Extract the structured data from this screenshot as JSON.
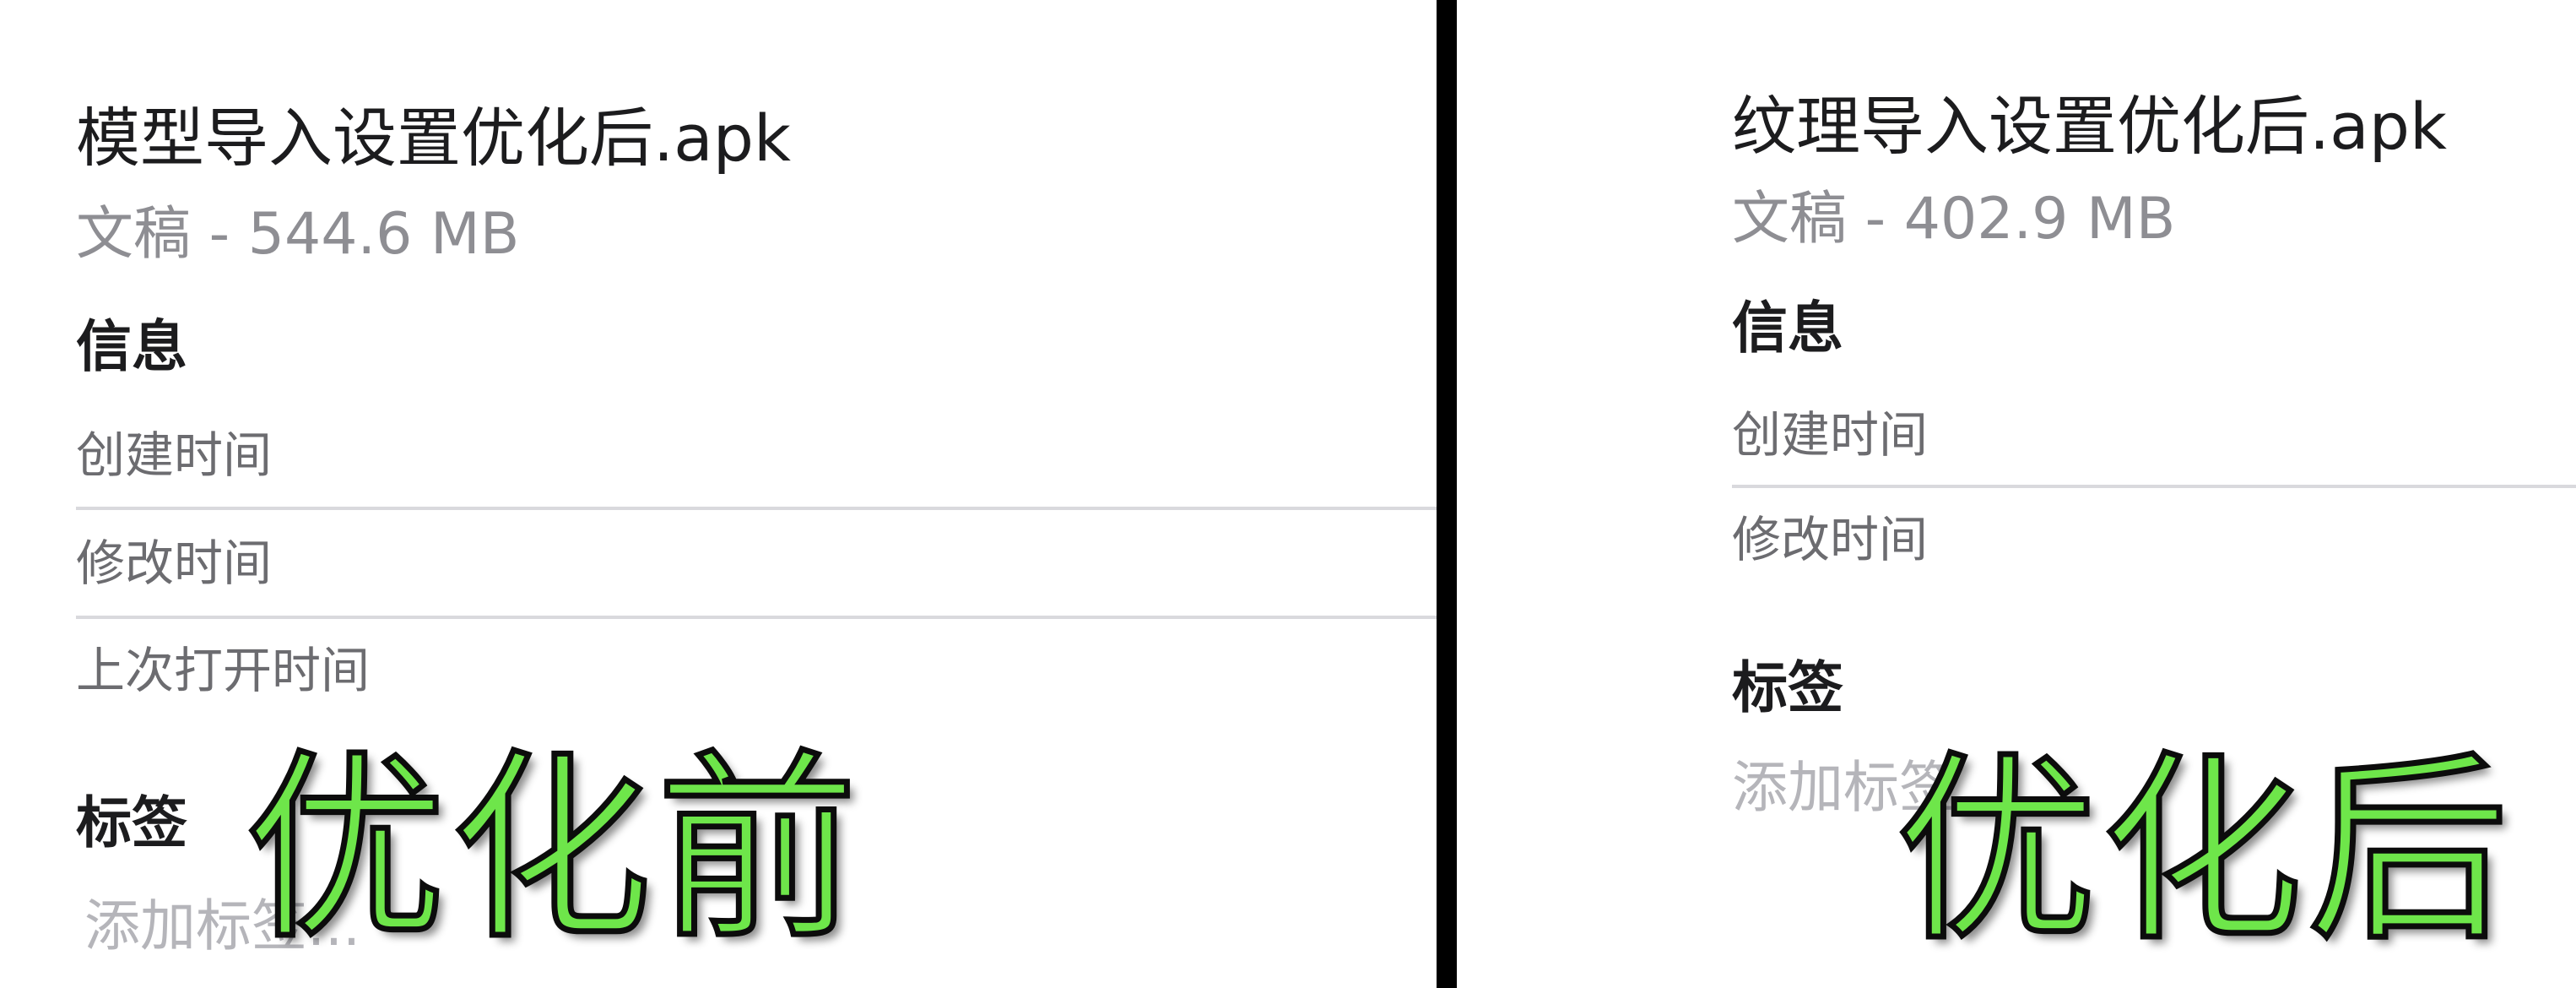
{
  "before": {
    "file_title": "模型导入设置优化后.apk",
    "file_subtitle": "文稿 - 544.6 MB",
    "info_heading": "信息",
    "info_rows": [
      "创建时间",
      "修改时间",
      "上次打开时间"
    ],
    "tags_heading": "标签",
    "tags_placeholder": "添加标签...",
    "overlay_label": "优化前"
  },
  "after": {
    "file_title": "纹理导入设置优化后.apk",
    "file_subtitle": "文稿 - 402.9 MB",
    "info_heading": "信息",
    "info_rows": [
      "创建时间",
      "修改时间"
    ],
    "tags_heading": "标签",
    "tags_placeholder": "添加标签...",
    "overlay_label": "优化后"
  },
  "colors": {
    "overlay_fill": "#6ee64a",
    "overlay_outline": "#0c0c0c",
    "divider": "#000000",
    "title_text": "#1c1c1e",
    "secondary_text": "#8e8e93"
  }
}
